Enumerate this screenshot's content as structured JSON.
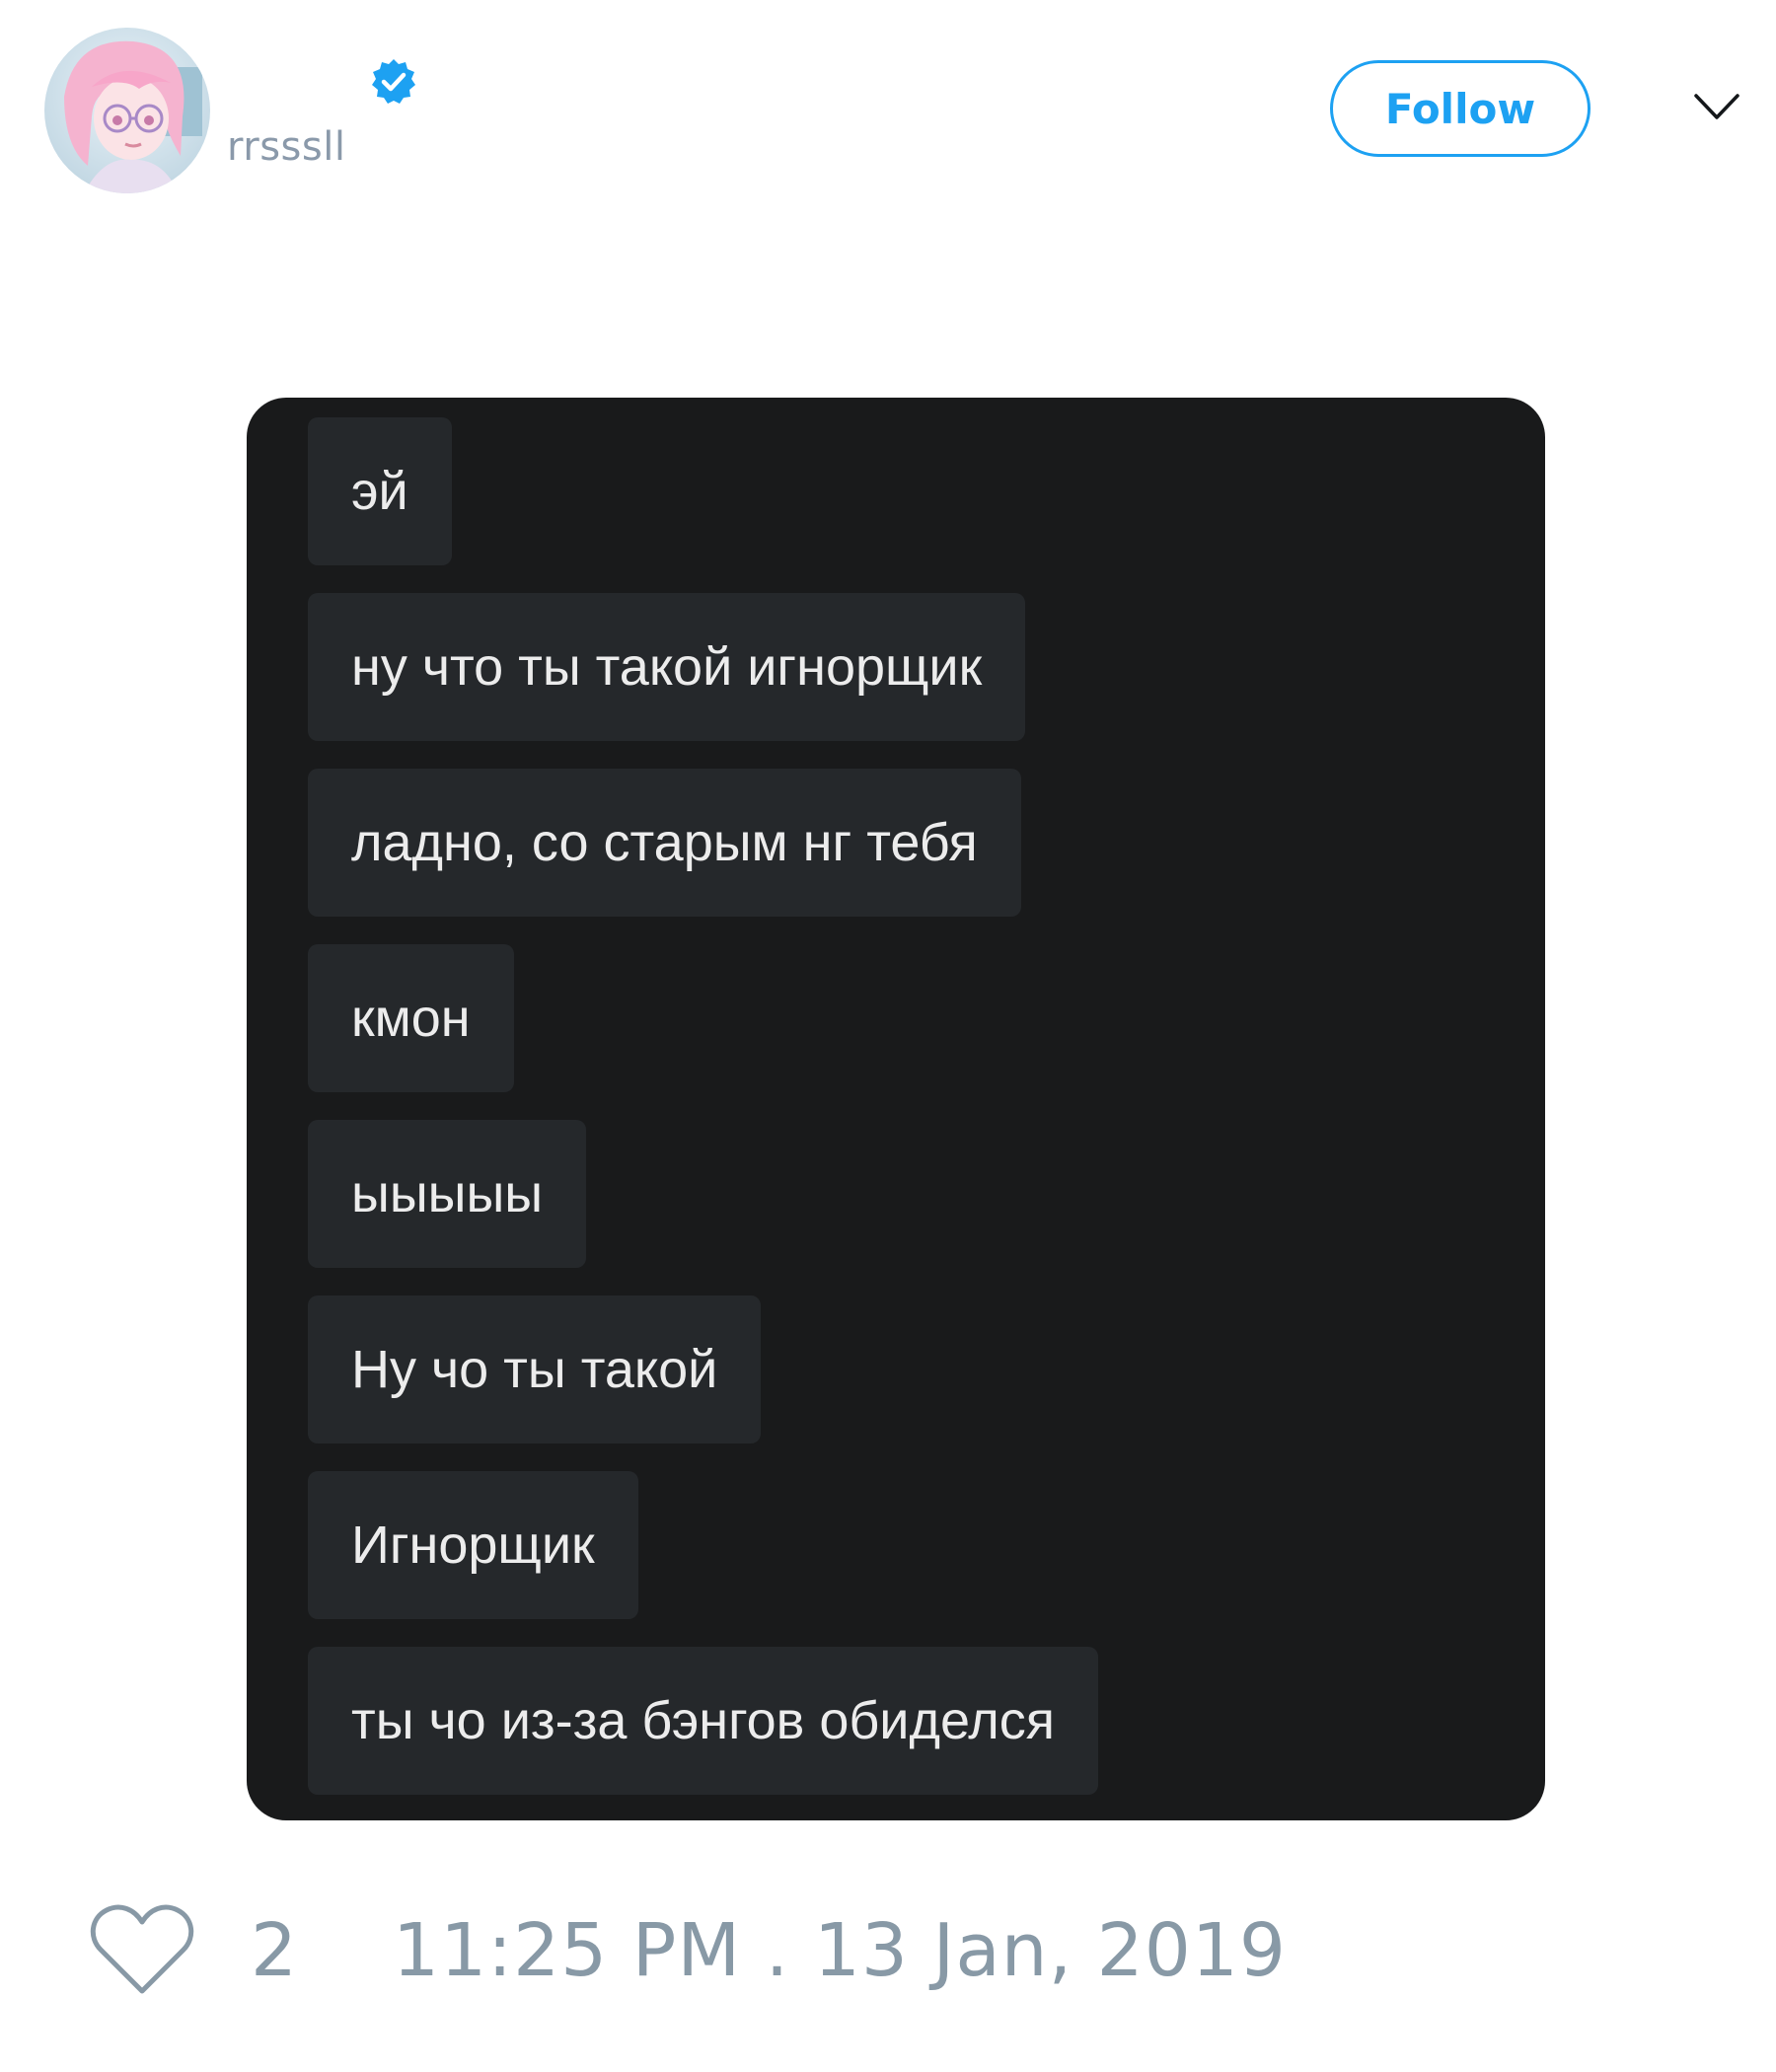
{
  "tweet": {
    "author": {
      "handle": "rrsssll",
      "verified": true,
      "avatar_icon": "anime-avatar-icon"
    },
    "follow_label": "Follow",
    "menu_icon": "chevron-down-icon",
    "messages": [
      "эй",
      "ну что ты такой игнорщик",
      "ладно, со старым нг тебя",
      "кмон",
      "ыыыыы",
      "Ну чо ты такой",
      "Игнорщик",
      "ты чо из-за бэнгов обиделся"
    ],
    "like_icon": "heart-icon",
    "like_count": "2",
    "timestamp": "11:25 PM . 13 Jan, 2019"
  },
  "colors": {
    "accent": "#1da1f2",
    "muted": "#8899a6",
    "chat_background": "#191a1b",
    "bubble_background": "#25282b",
    "bubble_text": "#ececec"
  }
}
